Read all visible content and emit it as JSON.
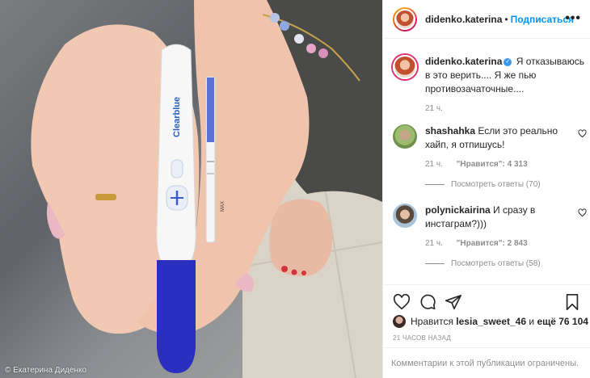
{
  "photo": {
    "credit": "© Екатерина Диденко",
    "test_brand": "Clearblue",
    "strip_label": "MAX"
  },
  "header": {
    "username": "didenko.katerina",
    "separator": "•",
    "follow_label": "Подписаться",
    "more_icon": "•••"
  },
  "caption": {
    "username": "didenko.katerina",
    "verified_mark": "✓",
    "text": "Я отказываюсь в это верить.... Я же пью противозачаточные....",
    "time": "21 ч."
  },
  "comments": [
    {
      "username": "shashahka",
      "text": "Если это реально хайп, я отпишусь!",
      "time": "21 ч.",
      "likes": "\"Нравится\": 4 313",
      "replies": "Посмотреть ответы (70)"
    },
    {
      "username": "polynickairina",
      "text": "И сразу в инстаграм?)))",
      "time": "21 ч.",
      "likes": "\"Нравится\": 2 843",
      "replies": "Посмотреть ответы (58)"
    }
  ],
  "likes": {
    "prefix": "Нравится",
    "user": "lesia_sweet_46",
    "middle": "и",
    "count": "ещё 76 104"
  },
  "post_time": "21 ЧАСОВ НАЗАД",
  "footer_text": "Комментарии к этой публикации ограничены.",
  "colors": {
    "accent": "#0095f6",
    "muted": "#8e8e8e",
    "text": "#262626",
    "verified": "#3897f0",
    "test_blue": "#2a2fbf"
  }
}
